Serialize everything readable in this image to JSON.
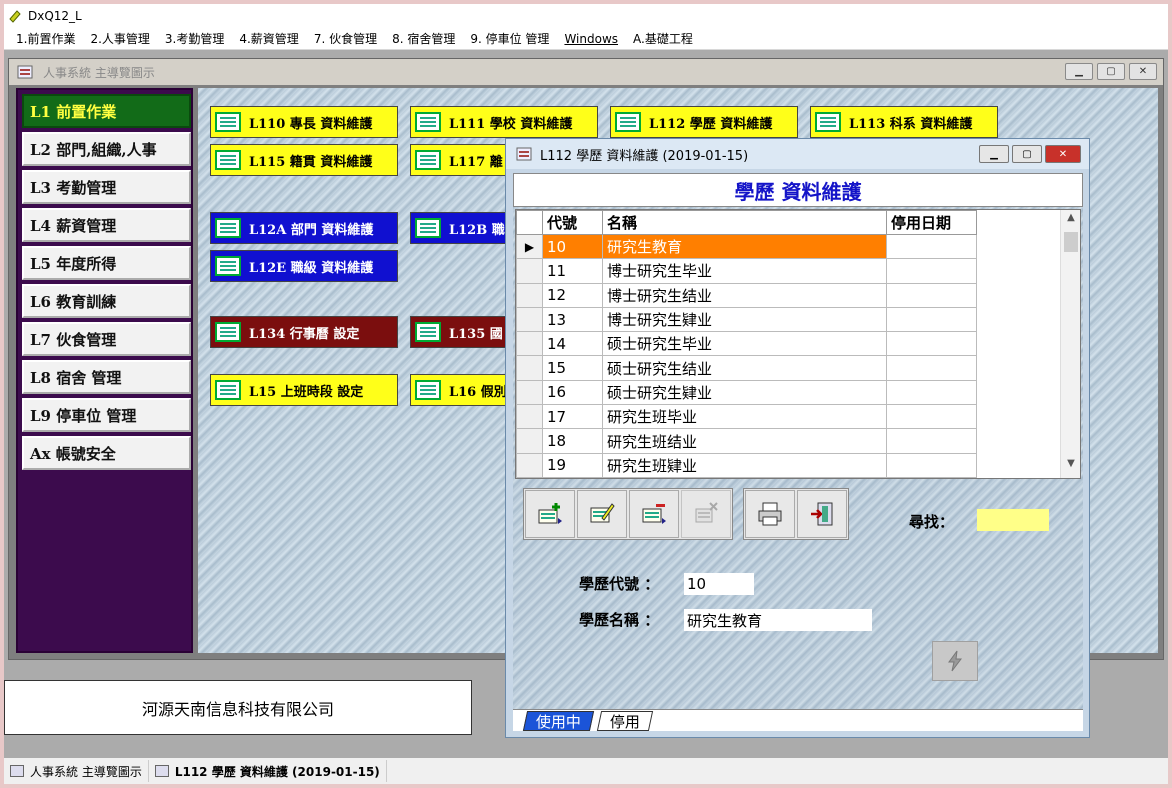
{
  "app": {
    "title": "DxQ12_L"
  },
  "menu": [
    "1.前置作業",
    "2.人事管理",
    "3.考勤管理",
    "4.薪資管理",
    "7. 伙食管理",
    "8. 宿舍管理",
    "9. 停車位 管理",
    "Windows",
    "A.基礎工程"
  ],
  "main_window": {
    "title": "人事系統  主導覽圖示"
  },
  "nav": [
    "L1  前置作業",
    "L2  部門,組織,人事",
    "L3  考勤管理",
    "L4  薪資管理",
    "L5  年度所得",
    "L6  教育訓練",
    "L7  伙食管理",
    "L8  宿舍  管理",
    "L9  停車位  管理",
    "Ax  帳號安全"
  ],
  "modules": [
    "L110  專長  資料維護",
    "L111  學校  資料維護",
    "L112  學歷  資料維護",
    "L113  科系  資料維護",
    "L115  籍貫  資料維護",
    "L117  離",
    "L12A  部門  資料維護",
    "L12B  職",
    "L12E  職級  資料維護",
    "L134  行事曆  設定",
    "L135  國",
    "L15  上班時段  設定",
    "L16  假別"
  ],
  "dialog": {
    "title": "L112 學歷 資料維護 (2019-01-15)",
    "heading": "學歷  資料維護",
    "columns": [
      "代號",
      "名稱",
      "停用日期"
    ],
    "rows": [
      {
        "code": "10",
        "name": "研究生教育",
        "date": ""
      },
      {
        "code": "11",
        "name": "博士研究生毕业",
        "date": ""
      },
      {
        "code": "12",
        "name": "博士研究生结业",
        "date": ""
      },
      {
        "code": "13",
        "name": "博士研究生肄业",
        "date": ""
      },
      {
        "code": "14",
        "name": "硕士研究生毕业",
        "date": ""
      },
      {
        "code": "15",
        "name": "硕士研究生结业",
        "date": ""
      },
      {
        "code": "16",
        "name": "硕士研究生肄业",
        "date": ""
      },
      {
        "code": "17",
        "name": "研究生班毕业",
        "date": ""
      },
      {
        "code": "18",
        "name": "研究生班结业",
        "date": ""
      },
      {
        "code": "19",
        "name": "研究生班肄业",
        "date": ""
      }
    ],
    "row_pointer": "▶",
    "search_label": "尋找：",
    "field_code_label": "學歷代號   ：",
    "field_code_value": "10",
    "field_name_label": "學歷名稱   ：",
    "field_name_value": "研究生教育",
    "tab_active": "使用中",
    "tab_inactive": "停用"
  },
  "company": "河源天南信息科技有限公司",
  "taskbar": [
    "人事系統  主導覽圖示",
    "L112 學歷 資料維護 (2019-01-15)"
  ],
  "colors": {
    "nav_active_bg": "#126b18",
    "module_yellow": "#ffff19",
    "module_blue": "#1010d0",
    "module_red": "#7b0e0e",
    "selected_row": "#ff7f00",
    "tab_active": "#1b54d8"
  }
}
